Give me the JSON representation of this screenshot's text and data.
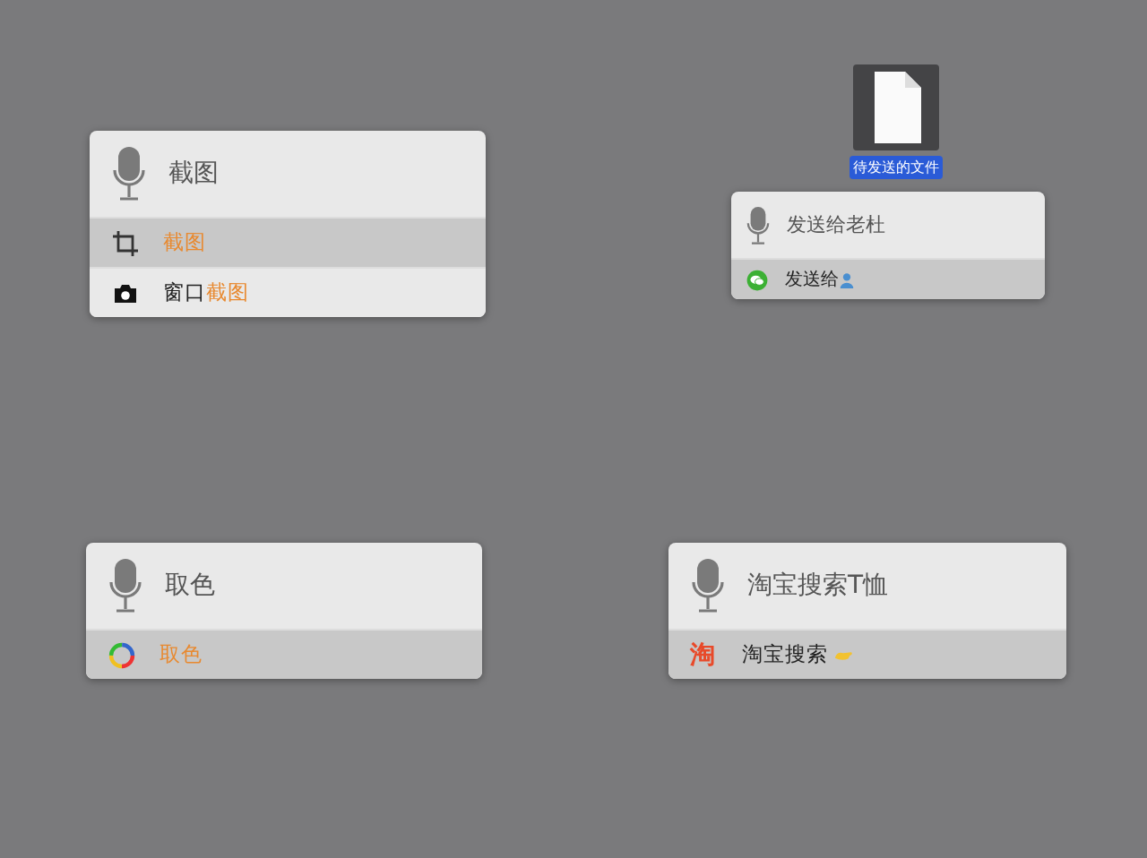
{
  "desktop_file": {
    "label": "待发送的文件",
    "selected": true
  },
  "panels": [
    {
      "query": "截图",
      "results": [
        {
          "kind": "crop",
          "selected": true,
          "parts": [
            {
              "text": "截图",
              "highlight": true
            }
          ]
        },
        {
          "kind": "camera",
          "selected": false,
          "parts": [
            {
              "text": "窗口",
              "highlight": false
            },
            {
              "text": "截图",
              "highlight": true
            }
          ]
        }
      ]
    },
    {
      "query": "发送给老杜",
      "results": [
        {
          "kind": "chat",
          "selected": true,
          "parts": [
            {
              "text": "发送给",
              "highlight": false
            }
          ],
          "badge": {
            "kind": "person"
          }
        }
      ]
    },
    {
      "query": "取色",
      "results": [
        {
          "kind": "color",
          "selected": true,
          "parts": [
            {
              "text": "取色",
              "highlight": true
            }
          ]
        }
      ]
    },
    {
      "query": "淘宝搜索T恤",
      "results": [
        {
          "kind": "shop",
          "icon_text": "淘",
          "selected": true,
          "parts": [
            {
              "text": "淘宝搜索",
              "highlight": false
            }
          ],
          "badge": {
            "kind": "hand"
          }
        }
      ]
    }
  ]
}
